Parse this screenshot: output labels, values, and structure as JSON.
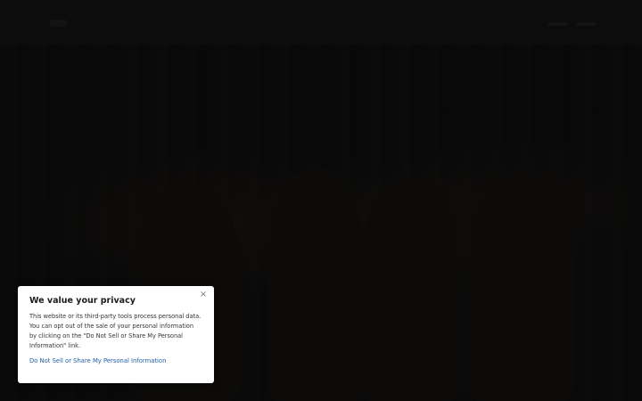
{
  "header": {
    "logo_icon": "site-logo-icon",
    "menu_icon": "menu-icon"
  },
  "hero": {
    "image": "band-photo"
  },
  "privacy_banner": {
    "title": "We value your privacy",
    "body": "This website or its third-party tools process personal data. You can opt out of the sale of your personal information by clicking on the \"Do Not Sell or Share My Personal Information\" link.",
    "link_label": "Do Not Sell or Share My Personal Information",
    "close_glyph": "×",
    "link_color": "#1d5fa8"
  }
}
